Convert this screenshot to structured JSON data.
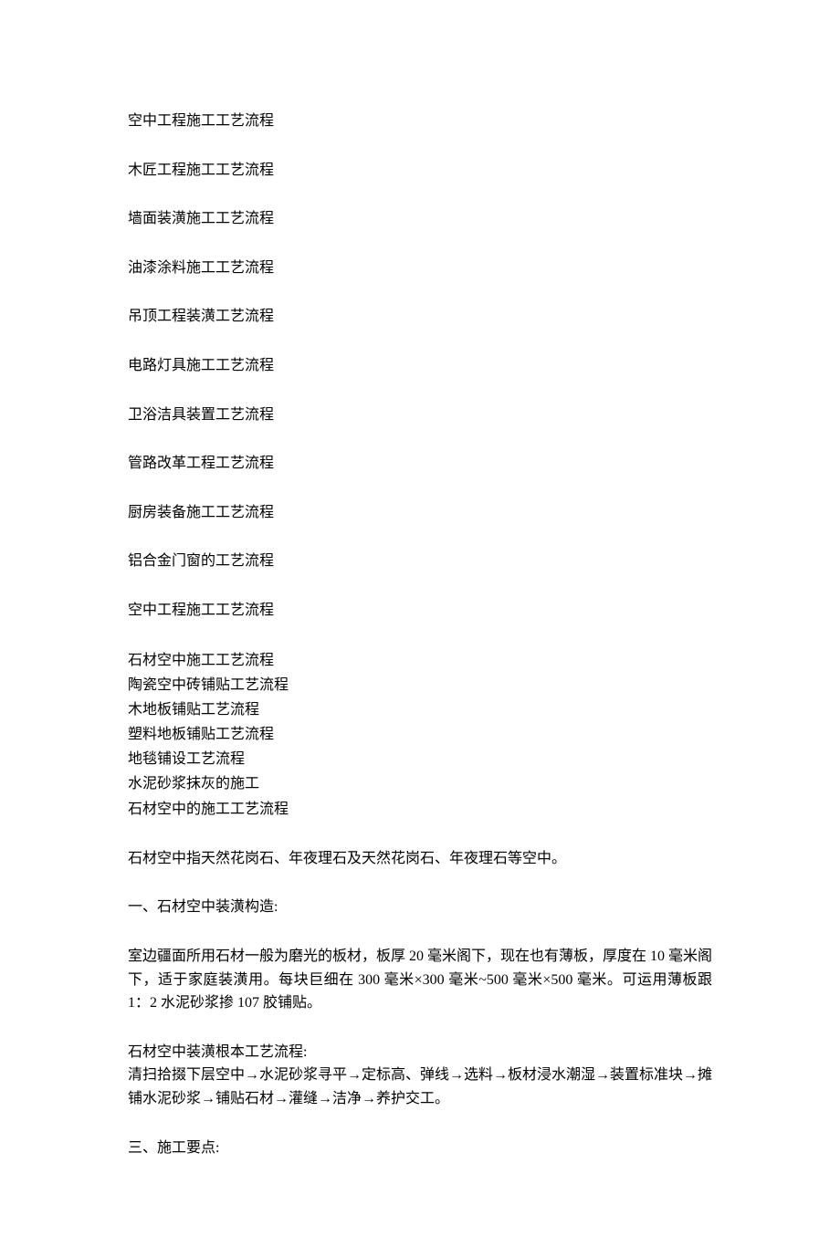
{
  "toc": [
    "空中工程施工工艺流程",
    "木匠工程施工工艺流程",
    "墙面装潢施工工艺流程",
    "油漆涂料施工工艺流程",
    "吊顶工程装潢工艺流程",
    "电路灯具施工工艺流程",
    "卫浴洁具装置工艺流程",
    "管路改革工程工艺流程",
    "厨房装备施工工艺流程",
    "铝合金门窗的工艺流程",
    "空中工程施工工艺流程"
  ],
  "sublist": [
    "石材空中施工工艺流程",
    "陶瓷空中砖铺贴工艺流程",
    "木地板铺贴工艺流程",
    "塑料地板铺贴工艺流程",
    "地毯铺设工艺流程",
    "水泥砂浆抹灰的施工",
    "石材空中的施工工艺流程"
  ],
  "p1": "石材空中指天然花岗石、年夜理石及天然花岗石、年夜理石等空中。",
  "h1": "一、石材空中装潢构造:",
  "p2": "室边疆面所用石材一般为磨光的板材，板厚 20 毫米阁下，现在也有薄板，厚度在 10 毫米阁下，适于家庭装潢用。每块巨细在 300 毫米×300 毫米~500 毫米×500 毫米。可运用薄板跟1：2 水泥砂浆掺 107 胶铺贴。",
  "h2": "石材空中装潢根本工艺流程:",
  "p3": "清扫拾掇下层空中→水泥砂浆寻平→定标高、弹线→选料→板材浸水潮湿→装置标准块→摊铺水泥砂浆→铺贴石材→灌缝→洁净→养护交工。",
  "h3": "三、施工要点:"
}
